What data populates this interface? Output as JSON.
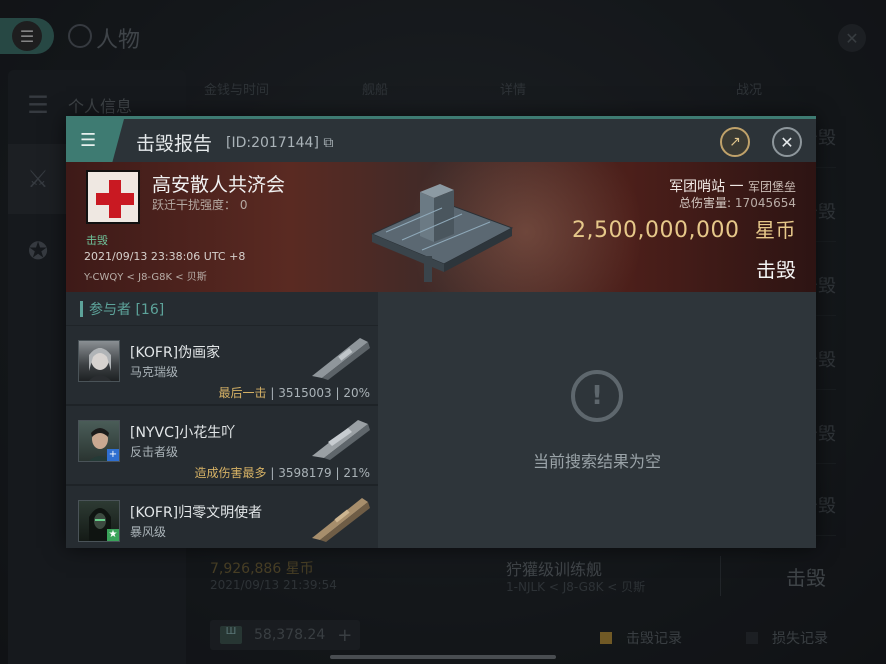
{
  "page": {
    "title": "人物"
  },
  "sidebar": {
    "items": [
      {
        "label": "个人信息"
      },
      {
        "label": ""
      },
      {
        "label": ""
      }
    ]
  },
  "list": {
    "headers": [
      "金钱与时间",
      "舰船",
      "详情",
      "战况"
    ],
    "row_result": "击毁",
    "bottom_row": {
      "price": "7,926,886 星币",
      "time": "2021/09/13 21:39:54",
      "ship": "狞獾级训练舰",
      "location": "1-NJLK < J8-G8K < 贝斯",
      "result": "击毁"
    }
  },
  "footer": {
    "wallet_amount": "58,378.24",
    "legend_kills": "击毁记录",
    "legend_losses": "损失记录",
    "colors": {
      "kills": "#c49a3a",
      "losses": "#2b3035"
    }
  },
  "modal": {
    "title": "击毁报告",
    "report_id": "[ID:2017144]",
    "victim": {
      "name": "高安散人共济会",
      "jam_strength": "跃迁干扰强度： 0",
      "kill_tag": "击毁",
      "time": "2021/09/13 23:38:06 UTC +8",
      "location": "Y-CWQY < J8-G8K < 贝斯",
      "ship_type": "军团哨站",
      "ship_class": "军团堡垒",
      "total_damage_label": "总伤害量:",
      "total_damage": "17045654",
      "isk_value": "2,500,000,000",
      "isk_unit": "星币",
      "result": "击毁"
    },
    "participants": {
      "header": "参与者 [16]",
      "rows": [
        {
          "name": "[KOFR]伪画家",
          "ship": "马克瑞级",
          "tag": "最后一击",
          "damage": "3515003",
          "percent": "20%"
        },
        {
          "name": "[NYVC]小花生吖",
          "ship": "反击者级",
          "tag": "造成伤害最多",
          "damage": "3598179",
          "percent": "21%"
        },
        {
          "name": "[KOFR]归零文明使者",
          "ship": "暴风级",
          "tag": "",
          "damage": "",
          "percent": ""
        }
      ]
    },
    "empty_text": "当前搜索结果为空"
  }
}
